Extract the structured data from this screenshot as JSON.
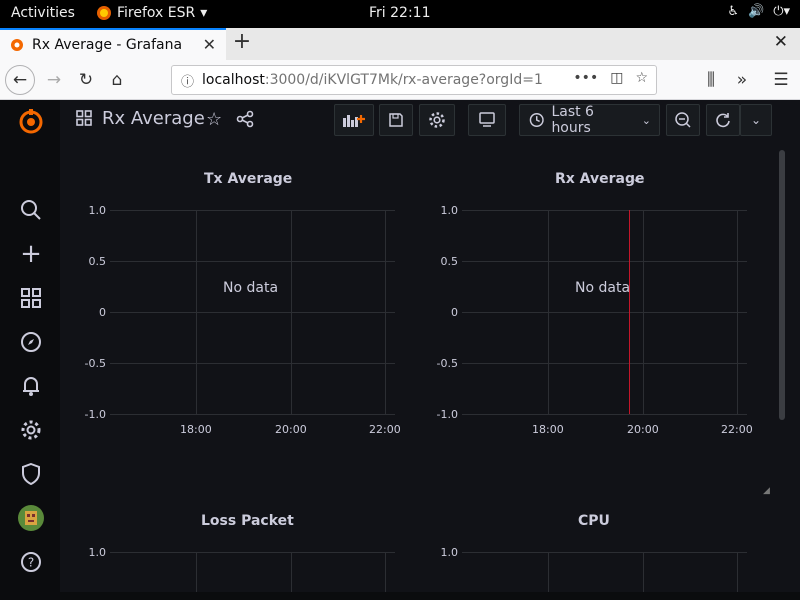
{
  "gnome": {
    "activities": "Activities",
    "app_name": "Firefox ESR",
    "clock": "Fri 22:11"
  },
  "browser": {
    "tab_title": "Rx Average - Grafana",
    "url_host": "localhost",
    "url_path": ":3000/d/iKVlGT7Mk/rx-average?orgId=1"
  },
  "grafana": {
    "dashboard_title": "Rx Average",
    "time_range": "Last 6 hours",
    "panels": [
      {
        "title": "Tx Average",
        "no_data": "No data"
      },
      {
        "title": "Rx Average",
        "no_data": "No data"
      },
      {
        "title": "Loss Packet"
      },
      {
        "title": "CPU"
      }
    ],
    "y_ticks": [
      "1.0",
      "0.5",
      "0",
      "-0.5",
      "-1.0"
    ],
    "x_ticks": [
      "18:00",
      "20:00",
      "22:00"
    ],
    "colors": {
      "accent": "#f46800",
      "annotation": "#c4162a",
      "bg": "#111217"
    }
  }
}
